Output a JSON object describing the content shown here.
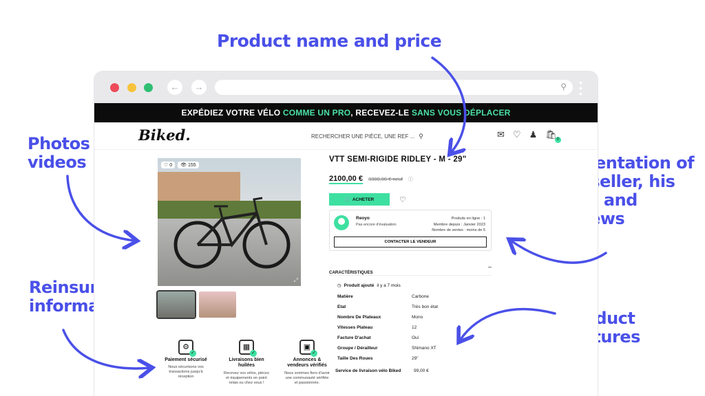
{
  "annotations": {
    "title_price": "Product name and price",
    "photos": "Photos & videos",
    "seller": "Presentation of the seller, his shop and reviews",
    "reinsurance": "Reinsurance information",
    "features": "Product features"
  },
  "colors": {
    "accent": "#3ee0a1",
    "annotation": "#4a50e8",
    "banner_bg": "#0c0c0c"
  },
  "banner": {
    "part1": "EXPÉDIEZ VOTRE VÉLO ",
    "highlight1": "COMME UN PRO",
    "part2": ", RECEVEZ-LE ",
    "highlight2": "SANS VOUS DÉPLACER"
  },
  "header": {
    "logo": "Biked.",
    "search_placeholder": "RECHERCHER UNE PIÈCE, UNE REF ...",
    "icons": [
      "mail-icon",
      "heart-icon",
      "user-icon",
      "cart-icon"
    ],
    "cart_count": "0"
  },
  "gallery": {
    "likes": "0",
    "views": "155"
  },
  "product": {
    "title": "VTT SEMI-RIGIDE RIDLEY - M - 29\"",
    "price": "2100,00 €",
    "old_price": "3300,00 € neuf",
    "buy_label": "ACHETER"
  },
  "seller": {
    "name": "Reoyo",
    "note": "Pas encore d'évaluation",
    "stats": [
      "Produits en ligne : 1",
      "Membre depuis : Janvier 2023",
      "Nombre de ventes : moins de 5"
    ],
    "contact_label": "CONTACTER LE VENDEUR"
  },
  "characteristics": {
    "title": "CARACTÉRISTIQUES",
    "added_label": "Produit ajouté",
    "added_value": "il y a 7 mois",
    "rows": [
      {
        "k": "Matière",
        "v": "Carbone"
      },
      {
        "k": "Etat",
        "v": "Très bon état"
      },
      {
        "k": "Nombre De Plateaux",
        "v": "Mono"
      },
      {
        "k": "Vitesses Plateau",
        "v": "12"
      },
      {
        "k": "Facture D'achat",
        "v": "Oui"
      },
      {
        "k": "Groupe / Dérailleur",
        "v": "Shimano XT"
      },
      {
        "k": "Taille Des Roues",
        "v": "29\""
      }
    ],
    "delivery": {
      "k": "Service de livraison vélo Biked",
      "v": "99,00 €"
    }
  },
  "reinsurance": [
    {
      "title": "Paiement sécurisé",
      "desc": "Nous sécurisons vos transactions jusqu'à réception"
    },
    {
      "title": "Livraisons bien huilées",
      "desc": "Recevez vos vélos, pièces et équipements en point relais ou chez vous !"
    },
    {
      "title": "Annonces & vendeurs vérifiés",
      "desc": "Nous sommes fiers d'avoir une communauté vérifiée et passionnée."
    }
  ]
}
